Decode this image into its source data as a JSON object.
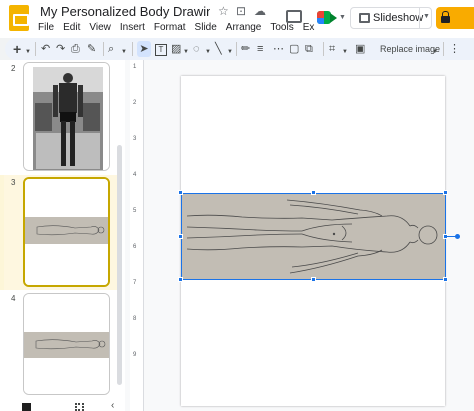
{
  "header": {
    "doc_title": "My Personalized Body Drawing Te...",
    "menu": [
      "File",
      "Edit",
      "View",
      "Insert",
      "Format",
      "Slide",
      "Arrange",
      "Tools",
      "Ex"
    ],
    "slideshow_label": "Slideshow",
    "icons": [
      "star-icon",
      "move-icon",
      "cloud-icon",
      "comment-icon",
      "meet-icon",
      "lock-icon"
    ]
  },
  "toolbar": {
    "replace_image_label": "Replace image"
  },
  "filmstrip": {
    "slides": [
      {
        "number": "2"
      },
      {
        "number": "3",
        "selected": true
      },
      {
        "number": "4"
      }
    ]
  },
  "ruler": {
    "labels": [
      "1",
      "2",
      "3",
      "4",
      "5",
      "6",
      "7",
      "8",
      "9"
    ]
  },
  "colors": {
    "accent": "#1a73e8",
    "share": "#f9ab00",
    "selected_slide": "#fef7e0",
    "app_icon": "#f4b400"
  }
}
